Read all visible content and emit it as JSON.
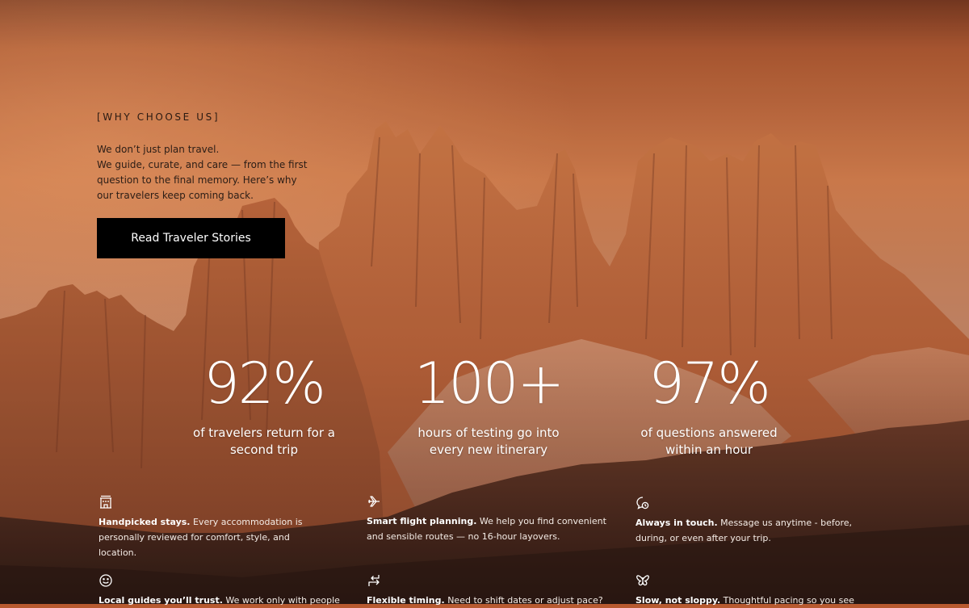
{
  "section": {
    "eyebrow": "[WHY CHOOSE US]",
    "intro_line1": "We don’t just plan travel.",
    "intro_line2": "We guide, curate, and care — from the first question to the final memory. Here’s why our travelers keep coming back.",
    "cta_label": "Read Traveler Stories"
  },
  "stats": [
    {
      "value": "92%",
      "caption": "of travelers return for a second trip"
    },
    {
      "value": "100+",
      "caption": "hours of testing go into every new itinerary"
    },
    {
      "value": "97%",
      "caption": "of questions answered within an hour"
    }
  ],
  "features": [
    {
      "icon": "hotel-icon",
      "title": "Handpicked stays.",
      "text": " Every accommodation is personally reviewed for comfort, style, and location."
    },
    {
      "icon": "plane-icon",
      "title": "Smart flight planning.",
      "text": " We help you find convenient and sensible routes — no 16-hour layovers."
    },
    {
      "icon": "chat-icon",
      "title": "Always in touch.",
      "text": " Message us anytime - before, during, or even after your trip."
    },
    {
      "icon": "smile-icon",
      "title": "Local guides you’ll trust.",
      "text": " We work only with people"
    },
    {
      "icon": "swap-arrows-icon",
      "title": "Flexible timing.",
      "text": " Need to shift dates or adjust pace?"
    },
    {
      "icon": "butterfly-icon",
      "title": "Slow, not sloppy.",
      "text": " Thoughtful pacing so you see"
    }
  ],
  "colors": {
    "sky_top": "#b8643d",
    "sky_mid": "#d98250",
    "rock": "#c4673c",
    "rock_dark": "#4a2a1e",
    "button": "#000000"
  }
}
